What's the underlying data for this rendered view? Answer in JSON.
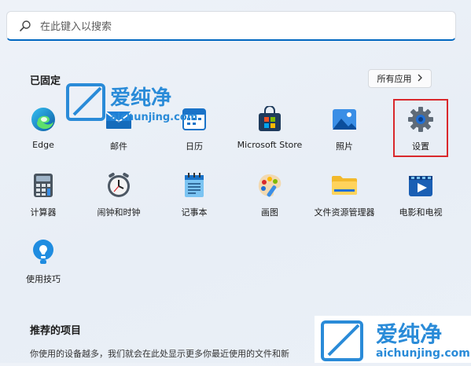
{
  "search": {
    "placeholder": "在此键入以搜索"
  },
  "pinned": {
    "title": "已固定",
    "all_apps_label": "所有应用",
    "apps": [
      {
        "label": "Edge",
        "icon": "edge-icon"
      },
      {
        "label": "邮件",
        "icon": "mail-icon"
      },
      {
        "label": "日历",
        "icon": "calendar-icon"
      },
      {
        "label": "Microsoft Store",
        "icon": "store-icon"
      },
      {
        "label": "照片",
        "icon": "photos-icon"
      },
      {
        "label": "设置",
        "icon": "settings-icon"
      },
      {
        "label": "计算器",
        "icon": "calculator-icon"
      },
      {
        "label": "闹钟和时钟",
        "icon": "clock-icon"
      },
      {
        "label": "记事本",
        "icon": "notepad-icon"
      },
      {
        "label": "画图",
        "icon": "paint-icon"
      },
      {
        "label": "文件资源管理器",
        "icon": "folder-icon"
      },
      {
        "label": "电影和电视",
        "icon": "movies-icon"
      },
      {
        "label": "使用技巧",
        "icon": "tips-icon"
      }
    ]
  },
  "recommended": {
    "title": "推荐的项目",
    "description": "你使用的设备越多，我们就会在此处显示更多你最近使用的文件和新"
  },
  "watermark": {
    "brand": "爱纯净",
    "url": "aichunjing.com"
  },
  "colors": {
    "accent": "#0067c0",
    "highlight": "#d9282c",
    "watermark": "#2a8bd8"
  }
}
